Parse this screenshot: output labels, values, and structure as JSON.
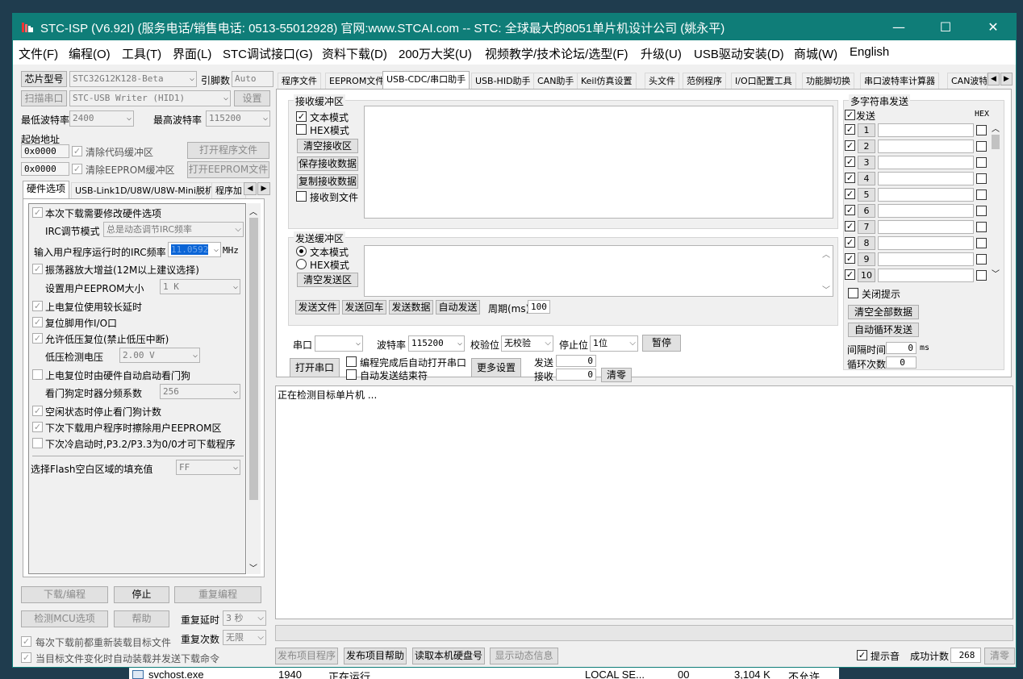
{
  "titlebar": {
    "title": "STC-ISP (V6.92I) (服务电话/销售电话: 0513-55012928) 官网:www.STCAI.com  -- STC: 全球最大的8051单片机设计公司 (姚永平)",
    "minimize": "—",
    "maximize": "☐",
    "close": "✕"
  },
  "menu": [
    "文件(F)",
    "编程(O)",
    "工具(T)",
    "界面(L)",
    "STC调试接口(G)",
    "资料下载(D)",
    "200万大奖(U)",
    "视频教学/技术论坛/选型(F)",
    "升级(U)",
    "USB驱动安装(D)",
    "商城(W)",
    "English"
  ],
  "left": {
    "chip_type_btn": "芯片型号",
    "chip_model": "STC32G12K128-Beta",
    "pin_label": "引脚数",
    "pin_value": "Auto",
    "scan_port_btn": "扫描串口",
    "port_value": "STC-USB Writer (HID1)",
    "settings_btn": "设置",
    "min_baud_label": "最低波特率",
    "min_baud": "2400",
    "max_baud_label": "最高波特率",
    "max_baud": "115200",
    "start_addr_label": "起始地址",
    "addr1": "0x0000",
    "clear_code_label": "清除代码缓冲区",
    "open_prog_btn": "打开程序文件",
    "addr2": "0x0000",
    "clear_eeprom_label": "清除EEPROM缓冲区",
    "open_eeprom_btn": "打开EEPROM文件",
    "tabs": [
      "硬件选项",
      "USB-Link1D/U8W/U8W-Mini脱机",
      "程序加"
    ],
    "hw": {
      "modify_hw": "本次下载需要修改硬件选项",
      "irc_mode_label": "IRC调节模式",
      "irc_mode_value": "总是动态调节IRC频率",
      "irc_freq_label": "输入用户程序运行时的IRC频率",
      "irc_freq_value": "11.0592",
      "irc_freq_unit": "MHz",
      "osc_gain": "振荡器放大增益(12M以上建议选择)",
      "eeprom_size_label": "设置用户EEPROM大小",
      "eeprom_size_value": "1   K",
      "power_reset_delay": "上电复位使用较长延时",
      "reset_pin_io": "复位脚用作I/O口",
      "low_volt_reset": "允许低压复位(禁止低压中断)",
      "low_volt_label": "低压检测电压",
      "low_volt_value": "2.00 V",
      "wdt_auto": "上电复位时由硬件自动启动看门狗",
      "wdt_div_label": "看门狗定时器分频系数",
      "wdt_div_value": "256",
      "idle_stop_wdt": "空闲状态时停止看门狗计数",
      "erase_eeprom": "下次下载用户程序时擦除用户EEPROM区",
      "cold_boot": "下次冷启动时,P3.2/P3.3为0/0才可下载程序",
      "flash_fill_label": "选择Flash空白区域的填充值",
      "flash_fill_value": "FF"
    },
    "download_btn": "下载/编程",
    "stop_btn": "停止",
    "reprogram_btn": "重复编程",
    "detect_btn": "检测MCU选项",
    "help_btn": "帮助",
    "repeat_delay_label": "重复延时",
    "repeat_delay_value": "3 秒",
    "repeat_count_label": "重复次数",
    "repeat_count_value": "无限",
    "reload_each": "每次下载前都重新装载目标文件",
    "auto_reload": "当目标文件变化时自动装载并发送下载命令"
  },
  "right": {
    "tabs": [
      "程序文件",
      "EEPROM文件",
      "USB-CDC/串口助手",
      "USB-HID助手",
      "CAN助手",
      "Keil仿真设置",
      "头文件",
      "范例程序",
      "I/O口配置工具",
      "功能脚切换",
      "串口波特率计算器",
      "CAN波特"
    ],
    "recv_group": "接收缓冲区",
    "recv_text_mode": "文本模式",
    "recv_hex_mode": "HEX模式",
    "clear_recv_btn": "清空接收区",
    "save_recv_btn": "保存接收数据",
    "copy_recv_btn": "复制接收数据",
    "recv_to_file": "接收到文件",
    "send_group": "发送缓冲区",
    "send_text_mode": "文本模式",
    "send_hex_mode": "HEX模式",
    "clear_send_btn": "清空发送区",
    "send_file_btn": "发送文件",
    "send_cr_btn": "发送回车",
    "send_data_btn": "发送数据",
    "auto_send_btn": "自动发送",
    "period_label": "周期(ms)",
    "period_value": "100",
    "port_label": "串口",
    "baud_label": "波特率",
    "baud_value": "115200",
    "parity_label": "校验位",
    "parity_value": "无校验",
    "stopbit_label": "停止位",
    "stopbit_value": "1位",
    "pause_btn": "暂停",
    "open_port_btn": "打开串口",
    "auto_open_label": "编程完成后自动打开串口",
    "auto_end_label": "自动发送结束符",
    "more_settings_btn": "更多设置",
    "send_count_label": "发送",
    "send_count": "0",
    "recv_count_label": "接收",
    "recv_count": "0",
    "clear_count_btn": "清零",
    "multi_group": "多字符串发送",
    "multi_send_label": "发送",
    "multi_hex_label": "HEX",
    "multi_rows": [
      "1",
      "2",
      "3",
      "4",
      "5",
      "6",
      "7",
      "8",
      "9",
      "10"
    ],
    "close_tip_label": "关闭提示",
    "clear_all_btn": "清空全部数据",
    "auto_loop_btn": "自动循环发送",
    "interval_label": "间隔时间",
    "interval_value": "0",
    "interval_unit": "ms",
    "loop_count_label": "循环次数",
    "loop_count_value": "0",
    "log_text": "正在检测目标单片机 ..."
  },
  "bottom": {
    "publish_prog_btn": "发布项目程序",
    "publish_help_btn": "发布项目帮助",
    "read_disk_btn": "读取本机硬盘号",
    "show_dynamic_btn": "显示动态信息",
    "beep_label": "提示音",
    "success_label": "成功计数",
    "success_value": "268",
    "clear_btn": "清零"
  },
  "behind": {
    "process": "svchost.exe",
    "pid": "1940",
    "status": "正在运行",
    "user": "LOCAL SE...",
    "cpu": "00",
    "mem": "3,104 K",
    "uac": "不允许"
  }
}
